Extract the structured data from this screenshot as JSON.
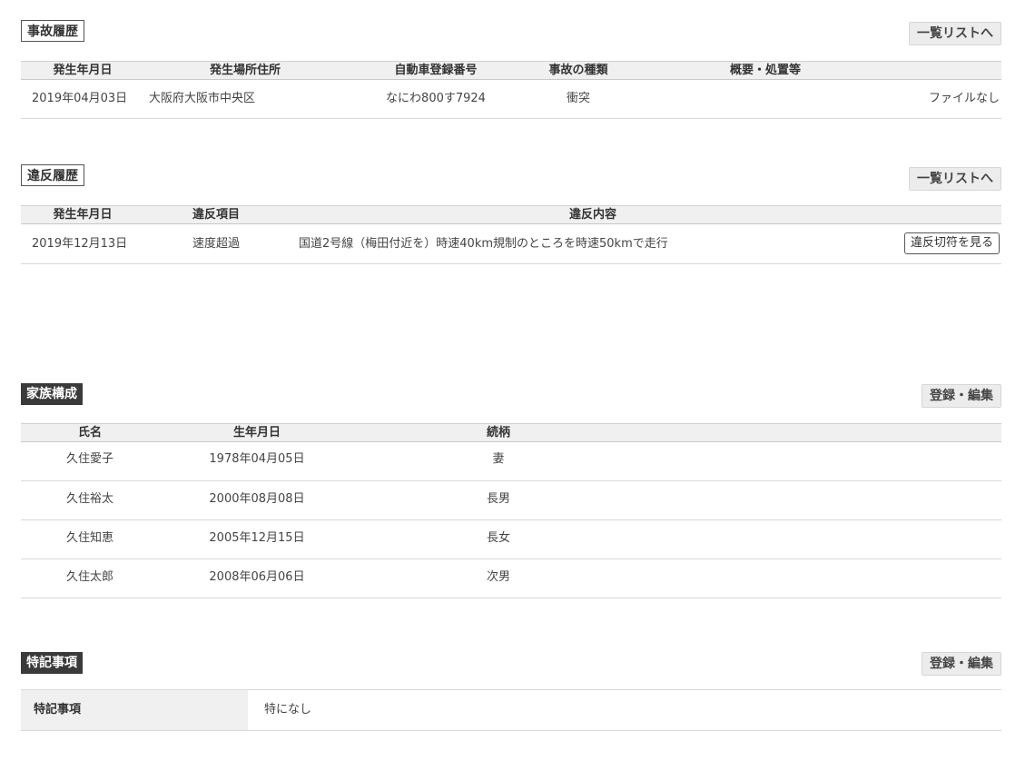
{
  "accident": {
    "title": "事故履歴",
    "list_button": "一覧リストへ",
    "headers": [
      "発生年月日",
      "発生場所住所",
      "自動車登録番号",
      "事故の種類",
      "概要・処置等"
    ],
    "rows": [
      {
        "date": "2019年04月03日",
        "place": "大阪府大阪市中央区",
        "plate": "なにわ800す7924",
        "type": "衝突",
        "file": "ファイルなし"
      }
    ]
  },
  "violation": {
    "title": "違反履歴",
    "list_button": "一覧リストへ",
    "headers": [
      "発生年月日",
      "違反項目",
      "違反内容"
    ],
    "rows": [
      {
        "date": "2019年12月13日",
        "item": "速度超過",
        "detail": "国道2号線（梅田付近を）時速40km規制のところを時速50kmで走行",
        "ticket_button": "違反切符を見る"
      }
    ]
  },
  "family": {
    "title": "家族構成",
    "edit_button": "登録・編集",
    "headers": [
      "氏名",
      "生年月日",
      "続柄"
    ],
    "rows": [
      {
        "name": "久住愛子",
        "birth": "1978年04月05日",
        "relation": "妻"
      },
      {
        "name": "久住裕太",
        "birth": "2000年08月08日",
        "relation": "長男"
      },
      {
        "name": "久住知恵",
        "birth": "2005年12月15日",
        "relation": "長女"
      },
      {
        "name": "久住太郎",
        "birth": "2008年06月06日",
        "relation": "次男"
      }
    ]
  },
  "notes": {
    "title": "特記事項",
    "edit_button": "登録・編集",
    "label": "特記事項",
    "value": "特になし"
  }
}
